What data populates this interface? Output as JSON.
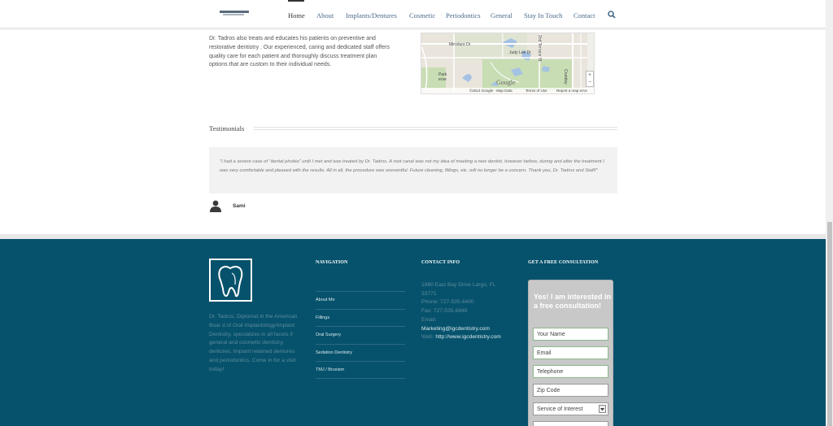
{
  "header": {
    "nav": [
      {
        "label": "Home",
        "name": "nav-home"
      },
      {
        "label": "About",
        "name": "nav-about"
      },
      {
        "label": "Implants/Dentures",
        "name": "nav-implants-dentures"
      },
      {
        "label": "Cosmetic",
        "name": "nav-cosmetic"
      },
      {
        "label": "Periodontics",
        "name": "nav-periodontics"
      },
      {
        "label": "General",
        "name": "nav-general"
      },
      {
        "label": "Stay In Touch",
        "name": "nav-stay-in-touch"
      },
      {
        "label": "Contact",
        "name": "nav-contact"
      }
    ],
    "search_icon": "search-icon"
  },
  "about": {
    "text": "Dr. Tadros also treats and educates his patients on preventive and restorative dentistry . Our experienced, caring and dedicated staff offers quality care for each patient and thoroughly discuss treatment plan options that are custom to their individual needs."
  },
  "map": {
    "labels": [
      "Mirrolure Dr",
      "Judy Lee Dr",
      "2nd Terrace St",
      "Crumley",
      "Park",
      "erve"
    ],
    "google": "Google",
    "attribution": "©2014 Google - Map Data",
    "terms": "Terms of Use",
    "report": "Report a map error",
    "zoom_in": "+",
    "zoom_out": "−"
  },
  "testimonials": {
    "title": "Testimonials",
    "quote": "\"I had a severe case of \"dental phobia\" until I met and was treated by Dr. Tadros. A root canal was not my idea of meeting a new dentist, however before, during and after the treatment I was very comfortable and pleased with the results. All in all, the procedure was uneventful. Future cleaning, fillings, etc. will no longer be a concern. Thank you, Dr. Tadros and Staff!\"",
    "author": "Sami"
  },
  "footer": {
    "about": "Dr. Tadros, Diplomat in the American Boar d of Oral Implantology/Implant Dentistry, specializes in all facets if general and cosmetic dentistry, dentures, implant retained dentures and periodontics. Come in for a visit today!",
    "navigation": {
      "title": "NAVIGATION",
      "items": [
        "About Me",
        "Fillings",
        "Oral Surgery",
        "Sedation Dentistry",
        "TMJ / Bruxism"
      ]
    },
    "contact": {
      "title": "CONTACT INFO",
      "address1": "1960 East Bay Drive Largo, FL",
      "address2": "33771",
      "phone": "Phone: 727-535-6400",
      "fax": "Fax: 727-535-6848",
      "email_label": "Email:",
      "email": "Marketing@igcdentistry.com",
      "web_label": "Web: ",
      "web": "http://www.igcdentistry.com"
    },
    "consultation": {
      "title": "GET A FREE CONSULTATION",
      "form_title": "Yes! I am interested in a free consultation!",
      "fields": [
        "Your Name",
        "Email",
        "Telephone",
        "Zip Code"
      ],
      "service_placeholder": "Service of Interest"
    }
  },
  "colors": {
    "footer_bg": "#06526c",
    "nav_link": "#4a6a8c"
  }
}
